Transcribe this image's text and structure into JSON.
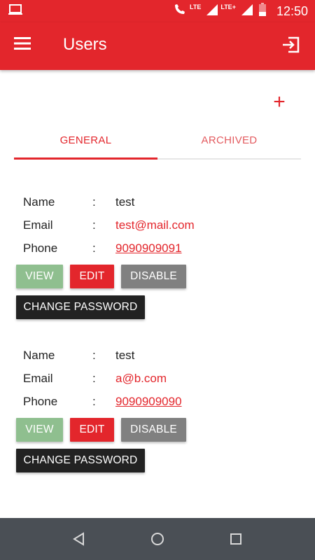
{
  "status_bar": {
    "network_label_1": "LTE",
    "network_label_2": "LTE+",
    "time": "12:50"
  },
  "app_bar": {
    "title": "Users",
    "menu_icon": "hamburger-menu-icon",
    "logout_icon": "logout-icon",
    "color": "#e3262c"
  },
  "add_label": "+",
  "tabs": [
    {
      "label": "GENERAL",
      "active": true
    },
    {
      "label": "ARCHIVED",
      "active": false
    }
  ],
  "field_labels": {
    "name": "Name",
    "email": "Email",
    "phone": "Phone",
    "separator": ":"
  },
  "users": [
    {
      "name": "test",
      "email": "test@mail.com",
      "phone": "9090909091"
    },
    {
      "name": "test",
      "email": "a@b.com",
      "phone": "9090909090"
    }
  ],
  "buttons": {
    "view": "VIEW",
    "edit": "EDIT",
    "disable": "DISABLE",
    "change_password": "CHANGE PASSWORD"
  },
  "colors": {
    "accent": "#e3262c",
    "view": "#8fbf8f",
    "disable": "#808080",
    "change_password": "#222222",
    "nav_bar": "#4a4f55"
  },
  "nav_bar": {
    "icons": [
      "back-icon",
      "home-icon",
      "recents-icon"
    ]
  }
}
